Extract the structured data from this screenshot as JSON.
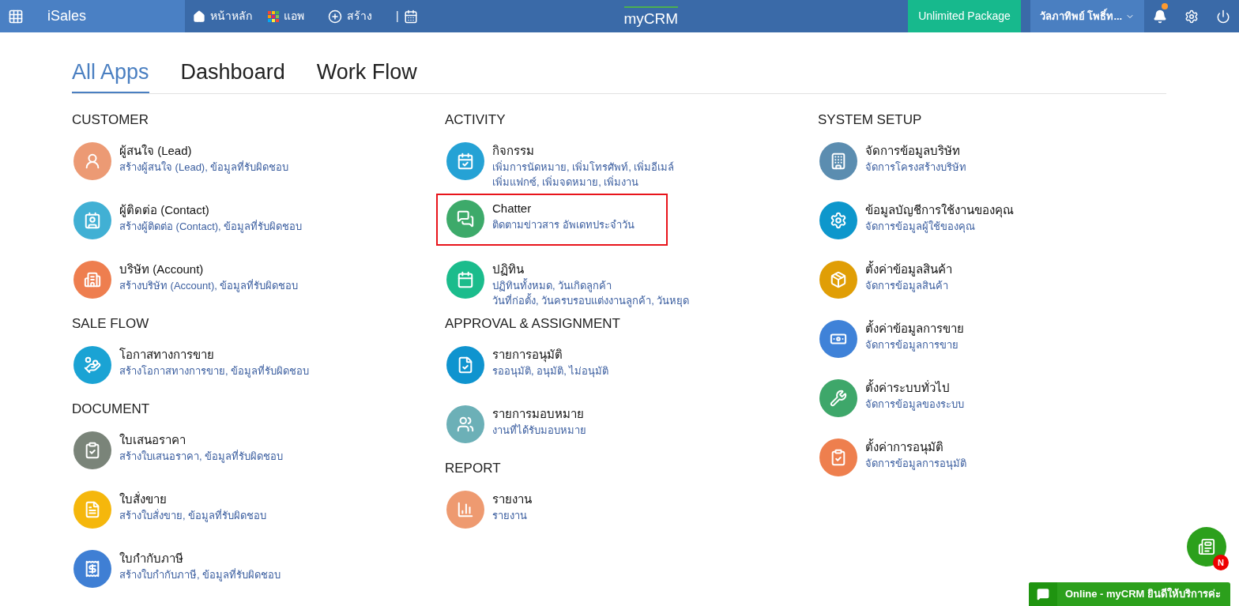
{
  "topbar": {
    "app_name": "iSales",
    "nav": [
      {
        "label": "หน้าหลัก",
        "kind": "home"
      },
      {
        "label": "แอพ",
        "kind": "apps"
      },
      {
        "label": "สร้าง",
        "kind": "create"
      },
      {
        "label": "|",
        "kind": "calendar"
      }
    ],
    "logo": "myCRM",
    "package": "Unlimited Package",
    "user": "วัลภาทิพย์ โพธิ์ท...",
    "notification_dot": true
  },
  "tabs": [
    {
      "label": "All Apps",
      "selected": true
    },
    {
      "label": "Dashboard",
      "selected": false
    },
    {
      "label": "Work Flow",
      "selected": false
    }
  ],
  "columns": [
    {
      "sections": [
        {
          "title": "CUSTOMER",
          "apps": [
            {
              "name": "ผู้สนใจ (Lead)",
              "description": "สร้างผู้สนใจ (Lead), ข้อมูลที่รับผิดชอบ",
              "color": "#ec9a74",
              "highlighted": false
            },
            {
              "name": "ผู้ติดต่อ (Contact)",
              "description": "สร้างผู้ติดต่อ (Contact), ข้อมูลที่รับผิดชอบ",
              "color": "#41b0d4",
              "highlighted": false
            },
            {
              "name": "บริษัท (Account)",
              "description": "สร้างบริษัท (Account), ข้อมูลที่รับผิดชอบ",
              "color": "#ee7e4f",
              "highlighted": false
            }
          ]
        },
        {
          "title": "SALE FLOW",
          "apps": [
            {
              "name": "โอกาสทางการขาย",
              "description": "สร้างโอกาสทางการขาย, ข้อมูลที่รับผิดชอบ",
              "color": "#1aa3d4",
              "highlighted": false
            }
          ]
        },
        {
          "title": "DOCUMENT",
          "apps": [
            {
              "name": "ใบเสนอราคา",
              "description": "สร้างใบเสนอราคา, ข้อมูลที่รับผิดชอบ",
              "color": "#7a8479",
              "highlighted": false
            },
            {
              "name": "ใบสั่งขาย",
              "description": "สร้างใบสั่งขาย, ข้อมูลที่รับผิดชอบ",
              "color": "#f5b70c",
              "highlighted": false
            },
            {
              "name": "ใบกำกับภาษี",
              "description": "สร้างใบกำกับภาษี, ข้อมูลที่รับผิดชอบ",
              "color": "#3f7fd4",
              "highlighted": false
            }
          ]
        }
      ]
    },
    {
      "sections": [
        {
          "title": "ACTIVITY",
          "apps": [
            {
              "name": "กิจกรรม",
              "description": "เพิ่มการนัดหมาย, เพิ่มโทรศัพท์, เพิ่มอีเมล์\nเพิ่มแฟกซ์, เพิ่มจดหมาย, เพิ่มงาน",
              "color": "#25a2d5",
              "highlighted": false
            },
            {
              "name": "Chatter",
              "description": "ติดตามข่าวสาร อัพเดทประจำวัน",
              "color": "#3daa6a",
              "highlighted": true
            },
            {
              "name": "ปฏิทิน",
              "description": "ปฏิทินทั้งหมด, วันเกิดลูกค้า\nวันที่ก่อตั้ง, วันครบรอบแต่งงานลูกค้า, วันหยุด",
              "color": "#1bbc8c",
              "highlighted": false
            }
          ]
        },
        {
          "title": "APPROVAL & ASSIGNMENT",
          "apps": [
            {
              "name": "รายการอนุมัติ",
              "description": "รออนุมัติ, อนุมัติ, ไม่อนุมัติ",
              "color": "#0f94cf",
              "highlighted": false
            },
            {
              "name": "รายการมอบหมาย",
              "description": "งานที่ได้รับมอบหมาย",
              "color": "#6cb0b7",
              "highlighted": false
            }
          ]
        },
        {
          "title": "REPORT",
          "apps": [
            {
              "name": "รายงาน",
              "description": "รายงาน",
              "color": "#ee9a70",
              "highlighted": false
            }
          ]
        }
      ]
    },
    {
      "sections": [
        {
          "title": "SYSTEM SETUP",
          "apps": [
            {
              "name": "จัดการข้อมูลบริษัท",
              "description": "จัดการโครงสร้างบริษัท",
              "color": "#5b8db0",
              "highlighted": false
            },
            {
              "name": "ข้อมูลบัญชีการใช้งานของคุณ",
              "description": "จัดการข้อมูลผู้ใช้ของคุณ",
              "color": "#0d97cc",
              "highlighted": false
            },
            {
              "name": "ตั้งค่าข้อมูลสินค้า",
              "description": "จัดการข้อมูลสินค้า",
              "color": "#e09e06",
              "highlighted": false
            },
            {
              "name": "ตั้งค่าข้อมูลการขาย",
              "description": "จัดการข้อมูลการขาย",
              "color": "#3f82d8",
              "highlighted": false
            },
            {
              "name": "ตั้งค่าระบบทั่วไป",
              "description": "จัดการข้อมูลของระบบ",
              "color": "#3ea76a",
              "highlighted": false
            },
            {
              "name": "ตั้งค่าการอนุมัติ",
              "description": "จัดการข้อมูลการอนุมัติ",
              "color": "#ee7f4e",
              "highlighted": false
            }
          ]
        }
      ]
    }
  ],
  "floating_badge": "N",
  "chat_bar": "Online - myCRM ยินดีให้บริการค่ะ"
}
